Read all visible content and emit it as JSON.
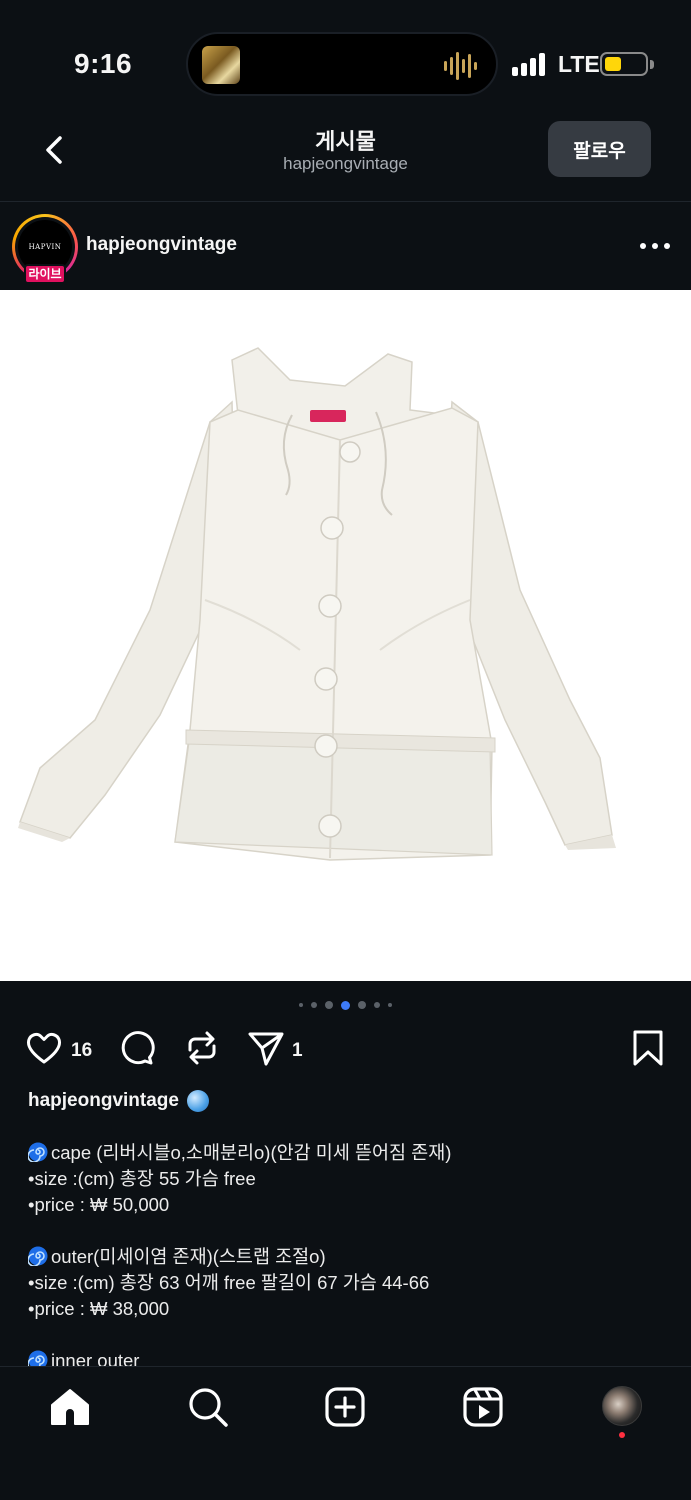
{
  "status_bar": {
    "time": "9:16",
    "network": "LTE",
    "battery_level": 0.3,
    "battery_color": "#ffd60a"
  },
  "header": {
    "title": "게시물",
    "subtitle": "hapjeongvintage",
    "follow_label": "팔로우"
  },
  "post": {
    "username": "hapjeongvintage",
    "avatar_text": "HAPVIN",
    "live_badge": "라이브",
    "carousel_total": 7,
    "carousel_active": 3,
    "likes": "16",
    "shares": "1",
    "accent_color": "#e0115f"
  },
  "caption": {
    "username": "hapjeongvintage",
    "lines": [
      "cape (리버시블o,소매분리o)(안감 미세 뜯어짐 존재)",
      "•size :(cm) 총장 55 가슴 free",
      "•price : ₩ 50,000",
      "",
      "outer(미세이염 존재)(스트랩 조절o)",
      "•size :(cm) 총장 63 어깨 free 팔길이 67 가슴 44-66",
      "•price : ₩ 38,000",
      "",
      "inner outer"
    ]
  },
  "icons": {
    "back": "chevron-left-icon",
    "more": "more-horizontal-icon",
    "like": "heart-icon",
    "comment": "comment-icon",
    "repost": "repost-icon",
    "share": "send-icon",
    "save": "bookmark-icon",
    "nav": [
      "home-icon",
      "search-icon",
      "create-icon",
      "reels-icon",
      "profile-avatar"
    ]
  }
}
